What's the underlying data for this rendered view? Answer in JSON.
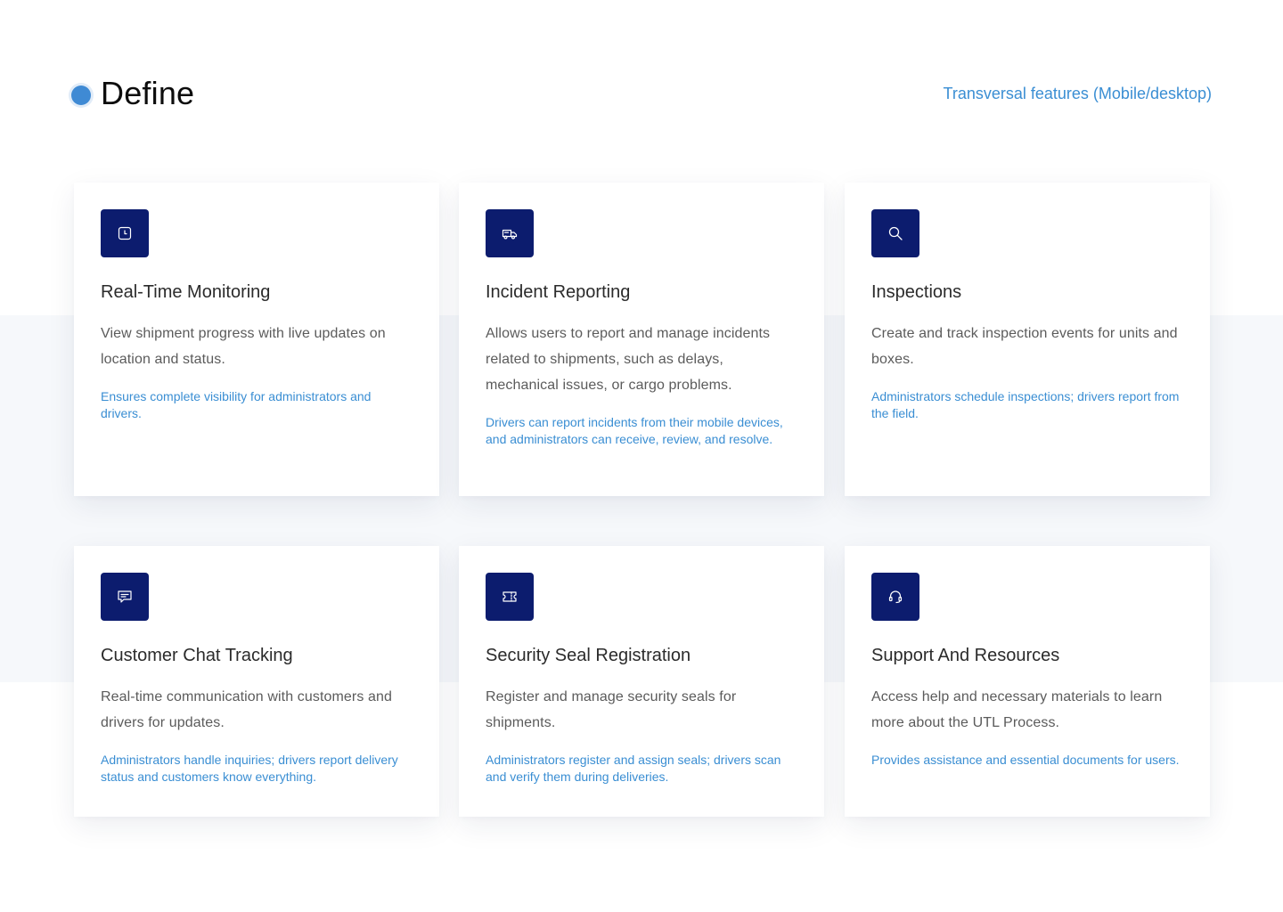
{
  "header": {
    "title": "Define",
    "link_label": "Transversal features (Mobile/desktop)"
  },
  "colors": {
    "accent": "#3a8ed3",
    "icon_background": "#0c1c6e",
    "band": "#f6f8fb"
  },
  "cards": [
    {
      "icon": "clock-icon",
      "title": "Real-Time Monitoring",
      "description": "View shipment progress with live updates on location and status.",
      "note": "Ensures complete visibility for administrators and drivers."
    },
    {
      "icon": "truck-icon",
      "title": "Incident Reporting",
      "description": "Allows users to report and manage incidents related to shipments, such as delays, mechanical issues, or cargo problems.",
      "note": "Drivers can report incidents from their mobile devices, and administrators can receive, review, and resolve."
    },
    {
      "icon": "search-icon",
      "title": "Inspections",
      "description": "Create and track inspection events for units and boxes.",
      "note": "Administrators schedule inspections; drivers report from the field."
    },
    {
      "icon": "chat-icon",
      "title": "Customer Chat Tracking",
      "description": "Real-time communication with customers and drivers for updates.",
      "note": "Administrators handle inquiries; drivers report delivery status and customers know everything."
    },
    {
      "icon": "seal-ticket-icon",
      "title": "Security Seal Registration",
      "description": "Register and manage security seals for shipments.",
      "note": "Administrators register and assign seals; drivers scan and verify them during deliveries."
    },
    {
      "icon": "headset-icon",
      "title": "Support And Resources",
      "description": "Access help and necessary materials to learn more about the UTL Process.",
      "note": "Provides assistance and essential documents for users."
    }
  ]
}
